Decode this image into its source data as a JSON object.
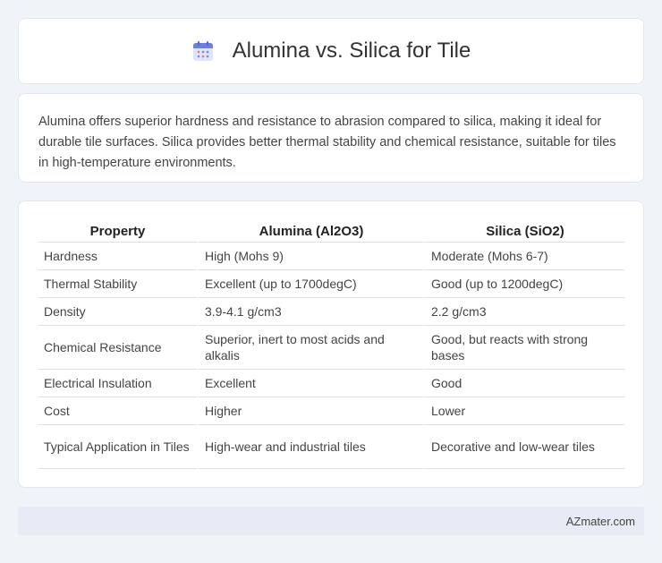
{
  "header": {
    "title": "Alumina vs. Silica for Tile",
    "icon": "calendar-icon"
  },
  "summary": {
    "text": "Alumina offers superior hardness and resistance to abrasion compared to silica, making it ideal for durable tile surfaces. Silica provides better thermal stability and chemical resistance, suitable for tiles in high-temperature environments."
  },
  "table": {
    "headers": [
      "Property",
      "Alumina (Al2O3)",
      "Silica (SiO2)"
    ],
    "rows": [
      [
        "Hardness",
        "High (Mohs 9)",
        "Moderate (Mohs 6-7)"
      ],
      [
        "Thermal Stability",
        "Excellent (up to 1700degC)",
        "Good (up to 1200degC)"
      ],
      [
        "Density",
        "3.9-4.1 g/cm3",
        "2.2 g/cm3"
      ],
      [
        "Chemical Resistance",
        "Superior, inert to most acids and alkalis",
        "Good, but reacts with strong bases"
      ],
      [
        "Electrical Insulation",
        "Excellent",
        "Good"
      ],
      [
        "Cost",
        "Higher",
        "Lower"
      ],
      [
        "Typical Application in Tiles",
        "High-wear and industrial tiles",
        "Decorative and low-wear tiles"
      ]
    ]
  },
  "footer": {
    "text": "AZmater.com"
  },
  "colors": {
    "background": "#f0f3f8",
    "card": "#ffffff",
    "footer": "#e6ebf5",
    "icon_accent": "#6b7fe0"
  }
}
